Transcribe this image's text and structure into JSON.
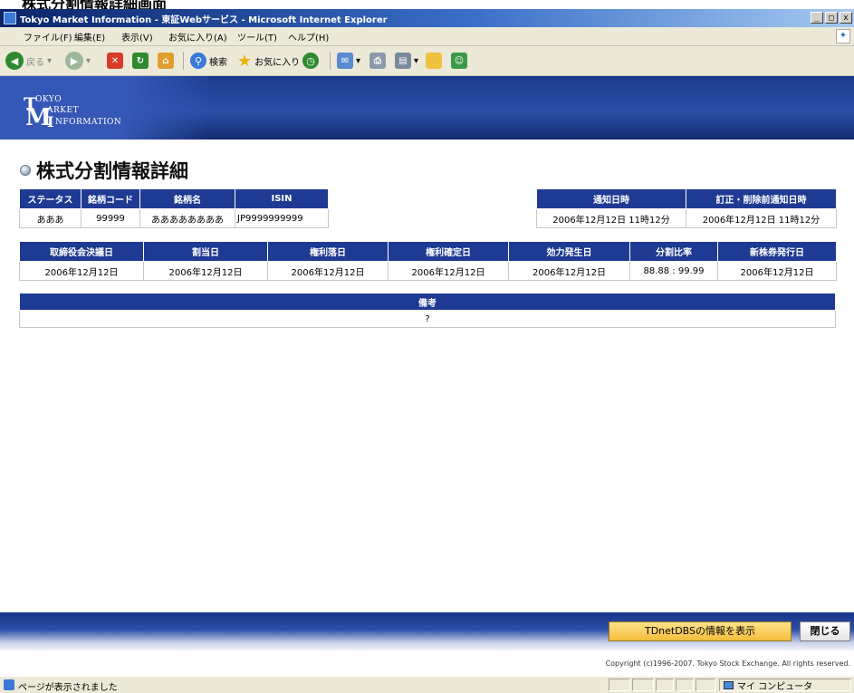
{
  "caption": "株式分割情報詳細画面",
  "window": {
    "title": "Tokyo Market Information - 東証Webサービス - Microsoft Internet Explorer",
    "buttons": [
      "_",
      "□",
      "x"
    ]
  },
  "menu": [
    "ファイル(F)",
    "編集(E)",
    "表示(V)",
    "お気に入り(A)",
    "ツール(T)",
    "ヘルプ(H)"
  ],
  "toolbar": {
    "back_label": "戻る",
    "search_label": "検索",
    "favorites_label": "お気に入り"
  },
  "header": {
    "logo_t": "T",
    "logo_okyo": "OKYO",
    "logo_m": "M",
    "logo_arket": "ARKET",
    "logo_i": "I",
    "logo_nformation": "NFORMATION"
  },
  "page_title": "株式分割情報詳細",
  "table1": {
    "headers": [
      "ステータス",
      "銘柄コード",
      "銘柄名",
      "ISIN"
    ],
    "row": [
      "あああ",
      "99999",
      "ああああああああ",
      "JP9999999999"
    ]
  },
  "table2": {
    "headers": [
      "通知日時",
      "訂正・削除前通知日時"
    ],
    "row": [
      "2006年12月12日 11時12分",
      "2006年12月12日 11時12分"
    ]
  },
  "table3": {
    "headers": [
      "取締役会決議日",
      "割当日",
      "権利落日",
      "権利確定日",
      "効力発生日",
      "分割比率",
      "新株券発行日"
    ],
    "row": [
      "2006年12月12日",
      "2006年12月12日",
      "2006年12月12日",
      "2006年12月12日",
      "2006年12月12日",
      "88.88 : 99.99",
      "2006年12月12日"
    ]
  },
  "table4": {
    "header": "備考",
    "value": "?"
  },
  "footer": {
    "tdnet_button": "TDnetDBSの情報を表示",
    "close_button": "閉じる",
    "copyright": "Copyright (c)1996-2007. Tokyo Stock Exchange. All rights reserved."
  },
  "status": {
    "text": "ページが表示されました",
    "zone": "マイ コンピュータ"
  },
  "colors": {
    "header_blue": "#1f3a93",
    "button_yellow": "#f4bd3c"
  }
}
